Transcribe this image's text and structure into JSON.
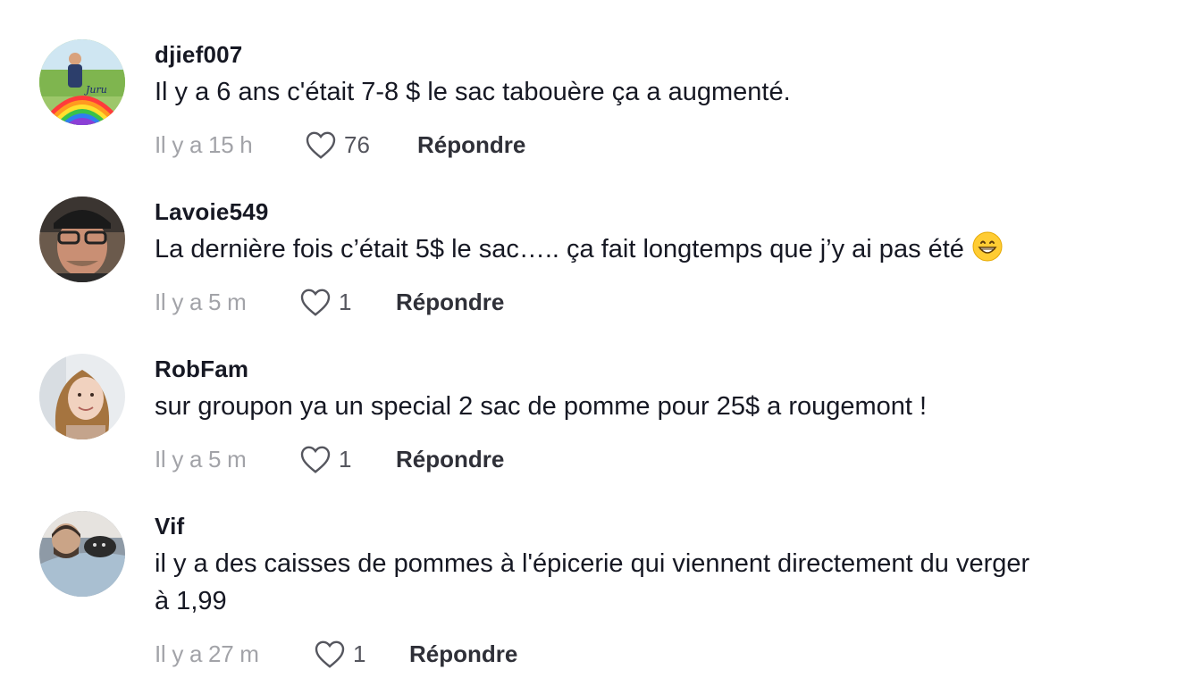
{
  "comments": [
    {
      "username": "djief007",
      "text": "Il y a 6 ans c'était 7-8 $ le sac tabouère ça a augmenté.",
      "time": "Il y a 15 h",
      "likes": "76",
      "reply_label": "Répondre"
    },
    {
      "username": "Lavoie549",
      "text": "La dernière fois c’était 5$ le sac….. ça fait longtemps que j’y ai pas été",
      "emoji": "grinning-face-emoji",
      "time": "Il y a 5 m",
      "likes": "1",
      "reply_label": "Répondre"
    },
    {
      "username": "RobFam",
      "text": "sur groupon ya un special 2 sac de pomme pour 25$ a rougemont !",
      "time": "Il y a 5 m",
      "likes": "1",
      "reply_label": "Répondre"
    },
    {
      "username": "Vif",
      "text_line1": "il y a des caisses de pommes à l'épicerie qui viennent directement du verger",
      "text_line2": "à 1,99",
      "time": "Il y a 27 m",
      "likes": "1",
      "reply_label": "Répondre"
    }
  ],
  "icons": {
    "like": "heart-outline-icon"
  },
  "colors": {
    "text": "#161823",
    "muted": "#a2a3a8",
    "reply": "#2f3038"
  }
}
